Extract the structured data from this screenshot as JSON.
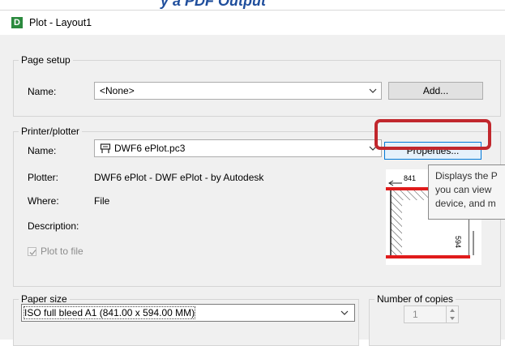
{
  "banner": {
    "text": "y a PDF Output"
  },
  "window": {
    "title": "Plot - Layout1",
    "app_icon_letter": "D"
  },
  "page_setup": {
    "group_label": "Page setup",
    "name_label": "Name:",
    "name_value": "<None>",
    "add_button": "Add..."
  },
  "printer": {
    "group_label": "Printer/plotter",
    "name_label": "Name:",
    "name_value": "DWF6 ePlot.pc3",
    "properties_button": "Properties...",
    "plotter_label": "Plotter:",
    "plotter_value": "DWF6 ePlot - DWF ePlot - by Autodesk",
    "where_label": "Where:",
    "where_value": "File",
    "description_label": "Description:",
    "plot_to_file_label": "Plot to file",
    "plot_to_file_checked": true,
    "tooltip_lines": [
      "Displays the P",
      "you can view",
      "device, and m"
    ],
    "preview_width_value": "841",
    "preview_height_value": "594"
  },
  "paper": {
    "group_label": "Paper size",
    "size_value": "ISO full bleed A1 (841.00 x 594.00 MM)"
  },
  "copies": {
    "group_label": "Number of copies",
    "value": "1"
  },
  "colors": {
    "highlight": "#c1272d",
    "app_icon": "#2b8a3e",
    "banner_text": "#1f4e9c"
  }
}
